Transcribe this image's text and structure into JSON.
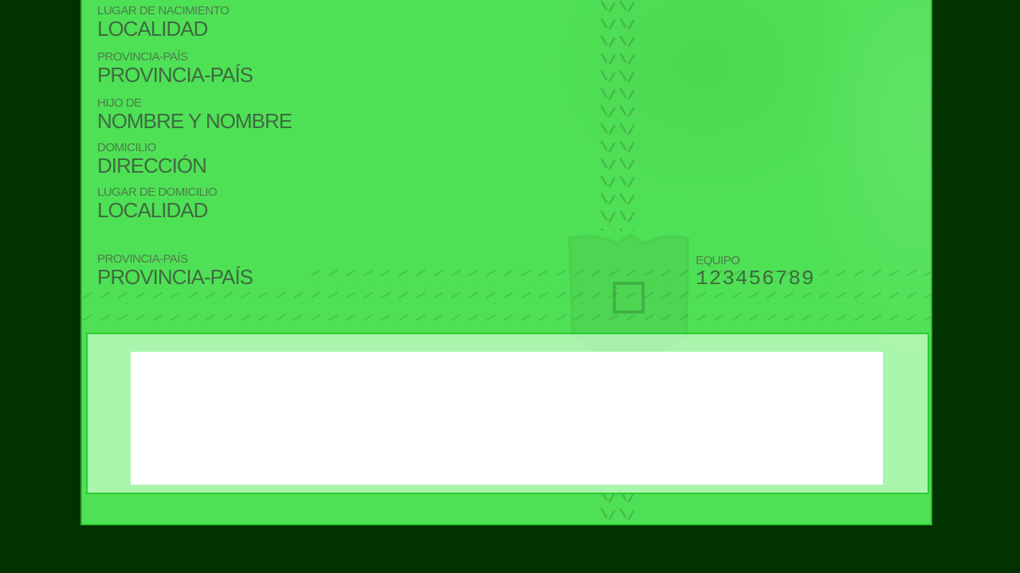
{
  "fields": {
    "birthplace": {
      "label": "LUGAR DE NACIMIENTO",
      "value": "LOCALIDAD"
    },
    "birth_province": {
      "label": "PROVINCIA-PAÍS",
      "value": "PROVINCIA-PAÍS"
    },
    "child_of": {
      "label": "HIJO DE",
      "value": "NOMBRE Y NOMBRE"
    },
    "address": {
      "label": "DOMICILIO",
      "value": "DIRECCIÓN"
    },
    "address_locality": {
      "label": "LUGAR DE DOMICILIO",
      "value": "LOCALIDAD"
    },
    "address_province": {
      "label": "PROVINCIA-PAÍS",
      "value": "PROVINCIA-PAÍS"
    },
    "equipment": {
      "label": "EQUIPO",
      "value": "123456789"
    }
  },
  "colors": {
    "background": "#003300",
    "card": "#4fe155",
    "band_border": "#2ccc33",
    "text": "#3e6b40"
  }
}
